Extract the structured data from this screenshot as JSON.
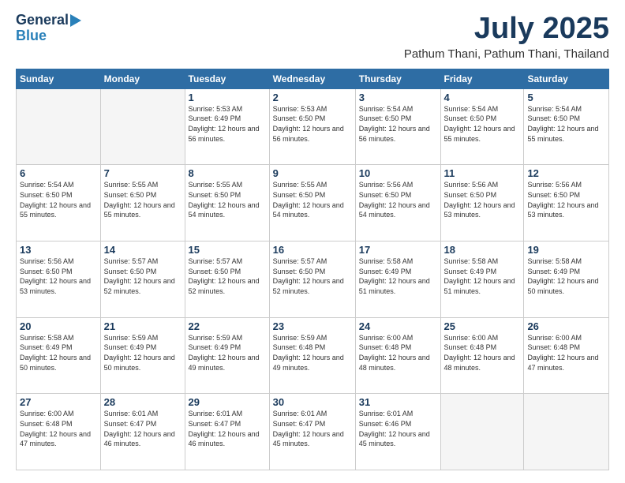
{
  "header": {
    "logo": {
      "line1": "General",
      "line2": "Blue"
    },
    "month": "July 2025",
    "location": "Pathum Thani, Pathum Thani, Thailand"
  },
  "weekdays": [
    "Sunday",
    "Monday",
    "Tuesday",
    "Wednesday",
    "Thursday",
    "Friday",
    "Saturday"
  ],
  "weeks": [
    [
      {
        "day": "",
        "empty": true
      },
      {
        "day": "",
        "empty": true
      },
      {
        "day": "1",
        "sunrise": "5:53 AM",
        "sunset": "6:49 PM",
        "daylight": "12 hours and 56 minutes."
      },
      {
        "day": "2",
        "sunrise": "5:53 AM",
        "sunset": "6:50 PM",
        "daylight": "12 hours and 56 minutes."
      },
      {
        "day": "3",
        "sunrise": "5:54 AM",
        "sunset": "6:50 PM",
        "daylight": "12 hours and 56 minutes."
      },
      {
        "day": "4",
        "sunrise": "5:54 AM",
        "sunset": "6:50 PM",
        "daylight": "12 hours and 55 minutes."
      },
      {
        "day": "5",
        "sunrise": "5:54 AM",
        "sunset": "6:50 PM",
        "daylight": "12 hours and 55 minutes."
      }
    ],
    [
      {
        "day": "6",
        "sunrise": "5:54 AM",
        "sunset": "6:50 PM",
        "daylight": "12 hours and 55 minutes."
      },
      {
        "day": "7",
        "sunrise": "5:55 AM",
        "sunset": "6:50 PM",
        "daylight": "12 hours and 55 minutes."
      },
      {
        "day": "8",
        "sunrise": "5:55 AM",
        "sunset": "6:50 PM",
        "daylight": "12 hours and 54 minutes."
      },
      {
        "day": "9",
        "sunrise": "5:55 AM",
        "sunset": "6:50 PM",
        "daylight": "12 hours and 54 minutes."
      },
      {
        "day": "10",
        "sunrise": "5:56 AM",
        "sunset": "6:50 PM",
        "daylight": "12 hours and 54 minutes."
      },
      {
        "day": "11",
        "sunrise": "5:56 AM",
        "sunset": "6:50 PM",
        "daylight": "12 hours and 53 minutes."
      },
      {
        "day": "12",
        "sunrise": "5:56 AM",
        "sunset": "6:50 PM",
        "daylight": "12 hours and 53 minutes."
      }
    ],
    [
      {
        "day": "13",
        "sunrise": "5:56 AM",
        "sunset": "6:50 PM",
        "daylight": "12 hours and 53 minutes."
      },
      {
        "day": "14",
        "sunrise": "5:57 AM",
        "sunset": "6:50 PM",
        "daylight": "12 hours and 52 minutes."
      },
      {
        "day": "15",
        "sunrise": "5:57 AM",
        "sunset": "6:50 PM",
        "daylight": "12 hours and 52 minutes."
      },
      {
        "day": "16",
        "sunrise": "5:57 AM",
        "sunset": "6:50 PM",
        "daylight": "12 hours and 52 minutes."
      },
      {
        "day": "17",
        "sunrise": "5:58 AM",
        "sunset": "6:49 PM",
        "daylight": "12 hours and 51 minutes."
      },
      {
        "day": "18",
        "sunrise": "5:58 AM",
        "sunset": "6:49 PM",
        "daylight": "12 hours and 51 minutes."
      },
      {
        "day": "19",
        "sunrise": "5:58 AM",
        "sunset": "6:49 PM",
        "daylight": "12 hours and 50 minutes."
      }
    ],
    [
      {
        "day": "20",
        "sunrise": "5:58 AM",
        "sunset": "6:49 PM",
        "daylight": "12 hours and 50 minutes."
      },
      {
        "day": "21",
        "sunrise": "5:59 AM",
        "sunset": "6:49 PM",
        "daylight": "12 hours and 50 minutes."
      },
      {
        "day": "22",
        "sunrise": "5:59 AM",
        "sunset": "6:49 PM",
        "daylight": "12 hours and 49 minutes."
      },
      {
        "day": "23",
        "sunrise": "5:59 AM",
        "sunset": "6:48 PM",
        "daylight": "12 hours and 49 minutes."
      },
      {
        "day": "24",
        "sunrise": "6:00 AM",
        "sunset": "6:48 PM",
        "daylight": "12 hours and 48 minutes."
      },
      {
        "day": "25",
        "sunrise": "6:00 AM",
        "sunset": "6:48 PM",
        "daylight": "12 hours and 48 minutes."
      },
      {
        "day": "26",
        "sunrise": "6:00 AM",
        "sunset": "6:48 PM",
        "daylight": "12 hours and 47 minutes."
      }
    ],
    [
      {
        "day": "27",
        "sunrise": "6:00 AM",
        "sunset": "6:48 PM",
        "daylight": "12 hours and 47 minutes."
      },
      {
        "day": "28",
        "sunrise": "6:01 AM",
        "sunset": "6:47 PM",
        "daylight": "12 hours and 46 minutes."
      },
      {
        "day": "29",
        "sunrise": "6:01 AM",
        "sunset": "6:47 PM",
        "daylight": "12 hours and 46 minutes."
      },
      {
        "day": "30",
        "sunrise": "6:01 AM",
        "sunset": "6:47 PM",
        "daylight": "12 hours and 45 minutes."
      },
      {
        "day": "31",
        "sunrise": "6:01 AM",
        "sunset": "6:46 PM",
        "daylight": "12 hours and 45 minutes."
      },
      {
        "day": "",
        "empty": true
      },
      {
        "day": "",
        "empty": true
      }
    ]
  ]
}
